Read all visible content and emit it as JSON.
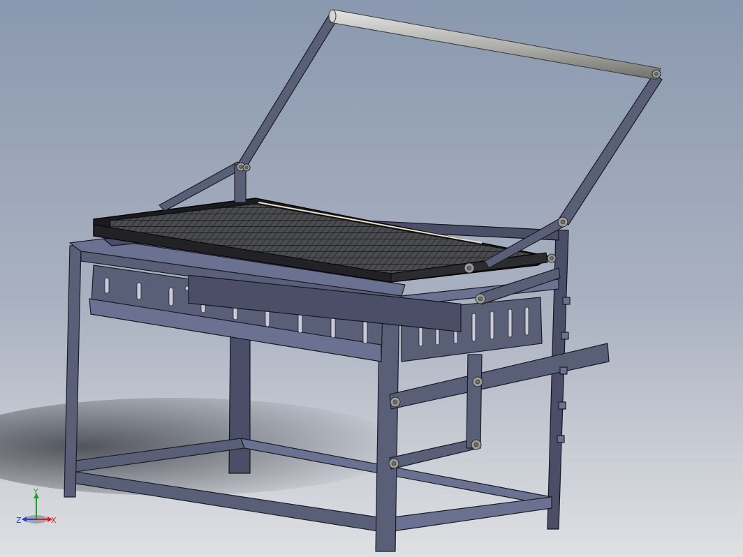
{
  "axis_triad": {
    "x_label": "X",
    "y_label": "Y",
    "z_label": "Z",
    "x_color": "#d42020",
    "y_color": "#20a020",
    "z_color": "#2040d0"
  },
  "colors": {
    "background_top": "#8e9bb1",
    "background_bottom": "#d8dade",
    "steel": "#5a5f78",
    "mesh_frame": "#1b1b1b",
    "handle_rod": "#b5b6b2"
  }
}
